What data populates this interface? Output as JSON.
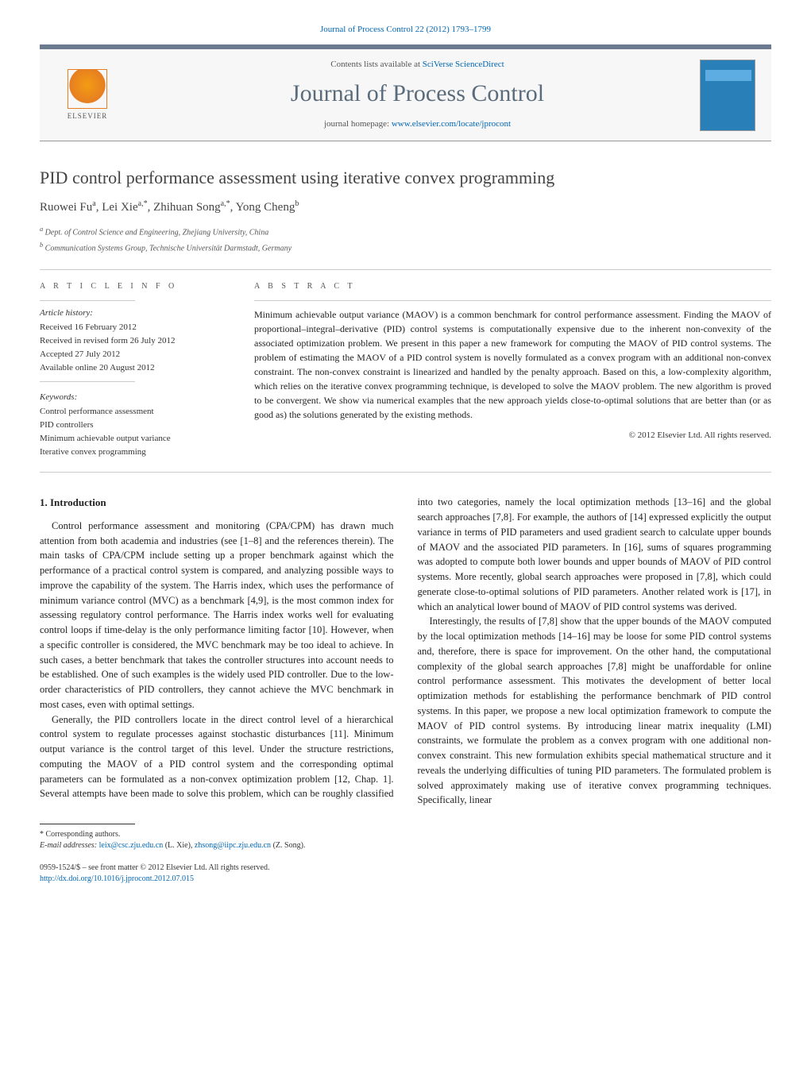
{
  "header": {
    "citation_line": "Journal of Process Control 22 (2012) 1793–1799",
    "contents_prefix": "Contents lists available at ",
    "contents_link": "SciVerse ScienceDirect",
    "journal_title": "Journal of Process Control",
    "homepage_prefix": "journal homepage: ",
    "homepage_link": "www.elsevier.com/locate/jprocont",
    "publisher_logo": "ELSEVIER"
  },
  "article": {
    "title": "PID control performance assessment using iterative convex programming",
    "authors_html": "Ruowei Fu",
    "authors": [
      {
        "name": "Ruowei Fu",
        "sup": "a"
      },
      {
        "name": "Lei Xie",
        "sup": "a,*"
      },
      {
        "name": "Zhihuan Song",
        "sup": "a,*"
      },
      {
        "name": "Yong Cheng",
        "sup": "b"
      }
    ],
    "affiliations": {
      "a": "Dept. of Control Science and Engineering, Zhejiang University, China",
      "b": "Communication Systems Group, Technische Universität Darmstadt, Germany"
    }
  },
  "info": {
    "section_label": "A R T I C L E   I N F O",
    "history_label": "Article history:",
    "history": [
      "Received 16 February 2012",
      "Received in revised form 26 July 2012",
      "Accepted 27 July 2012",
      "Available online 20 August 2012"
    ],
    "keywords_label": "Keywords:",
    "keywords": [
      "Control performance assessment",
      "PID controllers",
      "Minimum achievable output variance",
      "Iterative convex programming"
    ]
  },
  "abstract": {
    "section_label": "A B S T R A C T",
    "text": "Minimum achievable output variance (MAOV) is a common benchmark for control performance assessment. Finding the MAOV of proportional–integral–derivative (PID) control systems is computationally expensive due to the inherent non-convexity of the associated optimization problem. We present in this paper a new framework for computing the MAOV of PID control systems. The problem of estimating the MAOV of a PID control system is novelly formulated as a convex program with an additional non-convex constraint. The non-convex constraint is linearized and handled by the penalty approach. Based on this, a low-complexity algorithm, which relies on the iterative convex programming technique, is developed to solve the MAOV problem. The new algorithm is proved to be convergent. We show via numerical examples that the new approach yields close-to-optimal solutions that are better than (or as good as) the solutions generated by the existing methods.",
    "copyright": "© 2012 Elsevier Ltd. All rights reserved."
  },
  "body": {
    "section_heading": "1. Introduction",
    "paragraphs": [
      "Control performance assessment and monitoring (CPA/CPM) has drawn much attention from both academia and industries (see [1–8] and the references therein). The main tasks of CPA/CPM include setting up a proper benchmark against which the performance of a practical control system is compared, and analyzing possible ways to improve the capability of the system. The Harris index, which uses the performance of minimum variance control (MVC) as a benchmark [4,9], is the most common index for assessing regulatory control performance. The Harris index works well for evaluating control loops if time-delay is the only performance limiting factor [10]. However, when a specific controller is considered, the MVC benchmark may be too ideal to achieve. In such cases, a better benchmark that takes the controller structures into account needs to be established. One of such examples is the widely used PID controller. Due to the low-order characteristics of PID controllers, they cannot achieve the MVC benchmark in most cases, even with optimal settings.",
      "Generally, the PID controllers locate in the direct control level of a hierarchical control system to regulate processes against stochastic disturbances [11]. Minimum output variance is the control target of this level. Under the structure restrictions, computing the MAOV of a PID control system and the corresponding optimal parameters can be formulated as a non-convex optimization problem [12, Chap. 1]. Several attempts have been made to solve this problem, which can be roughly classified into two categories, namely the local optimization methods [13–16] and the global search approaches [7,8]. For example, the authors of [14] expressed explicitly the output variance in terms of PID parameters and used gradient search to calculate upper bounds of MAOV and the associated PID parameters. In [16], sums of squares programming was adopted to compute both lower bounds and upper bounds of MAOV of PID control systems. More recently, global search approaches were proposed in [7,8], which could generate close-to-optimal solutions of PID parameters. Another related work is [17], in which an analytical lower bound of MAOV of PID control systems was derived.",
      "Interestingly, the results of [7,8] show that the upper bounds of the MAOV computed by the local optimization methods [14–16] may be loose for some PID control systems and, therefore, there is space for improvement. On the other hand, the computational complexity of the global search approaches [7,8] might be unaffordable for online control performance assessment. This motivates the development of better local optimization methods for establishing the performance benchmark of PID control systems. In this paper, we propose a new local optimization framework to compute the MAOV of PID control systems. By introducing linear matrix inequality (LMI) constraints, we formulate the problem as a convex program with one additional non-convex constraint. This new formulation exhibits special mathematical structure and it reveals the underlying difficulties of tuning PID parameters. The formulated problem is solved approximately making use of iterative convex programming techniques. Specifically, linear"
    ]
  },
  "footnotes": {
    "corresponding_label": "* Corresponding authors.",
    "email_label": "E-mail addresses: ",
    "emails": [
      {
        "addr": "leix@csc.zju.edu.cn",
        "who": "(L. Xie)"
      },
      {
        "addr": "zhsong@iipc.zju.edu.cn",
        "who": "(Z. Song)"
      }
    ]
  },
  "footer": {
    "issn_line": "0959-1524/$ – see front matter © 2012 Elsevier Ltd. All rights reserved.",
    "doi": "http://dx.doi.org/10.1016/j.jprocont.2012.07.015"
  }
}
